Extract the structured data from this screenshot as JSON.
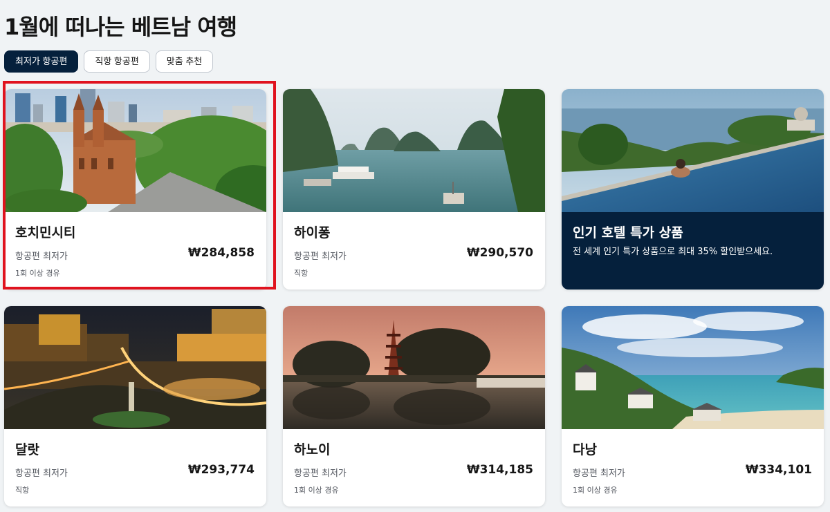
{
  "page": {
    "title": "1월에 떠나는 베트남 여행"
  },
  "filters": [
    {
      "label": "최저가 항공편",
      "active": true
    },
    {
      "label": "직항 항공편",
      "active": false
    },
    {
      "label": "맞춤 추천",
      "active": false
    }
  ],
  "cards": [
    {
      "city": "호치민시티",
      "price_label": "항공편 최저가",
      "price": "₩284,858",
      "stops": "1회 이상 경유",
      "image": "saigon-cathedral-photo"
    },
    {
      "city": "하이퐁",
      "price_label": "항공편 최저가",
      "price": "₩290,570",
      "stops": "직항",
      "image": "ha-long-bay-photo"
    },
    {
      "promo_title": "인기 호텔 특가 상품",
      "promo_desc": "전 세계 인기 특가 상품으로 최대 35% 할인받으세요.",
      "image": "infinity-pool-photo"
    },
    {
      "city": "달랏",
      "price_label": "항공편 최저가",
      "price": "₩293,774",
      "stops": "직항",
      "image": "dalat-night-photo"
    },
    {
      "city": "하노이",
      "price_label": "항공편 최저가",
      "price": "₩314,185",
      "stops": "1회 이상 경유",
      "image": "hanoi-pagoda-photo"
    },
    {
      "city": "다낭",
      "price_label": "항공편 최저가",
      "price": "₩334,101",
      "stops": "1회 이상 경유",
      "image": "danang-beach-photo"
    }
  ],
  "colors": {
    "brand_navy": "#05203c",
    "highlight_red": "#e0131f",
    "page_bg": "#f0f3f5"
  }
}
